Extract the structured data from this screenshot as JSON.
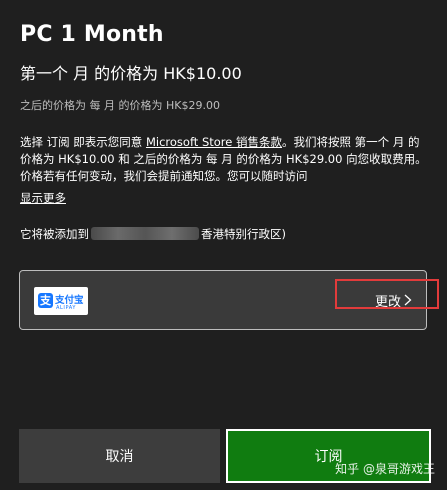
{
  "header": {
    "title": "PC 1 Month",
    "subtitle": "第一个 月 的价格为 HK$10.00",
    "after_price": "之后的价格为 每 月 的价格为 HK$29.00"
  },
  "terms": {
    "prefix": "选择 订阅 即表示您同意 ",
    "link": "Microsoft Store 销售条款",
    "suffix": "。我们将按照 第一个 月 的价格为 HK$10.00 和 之后的价格为 每 月 的价格为 HK$29.00 向您收取费用。价格若有任何变动，我们会提前通知您。您可以随时访问",
    "show_more": "显示更多"
  },
  "account": {
    "prefix": "它将被添加到",
    "suffix": "香港特别行政区)"
  },
  "payment": {
    "method_name": "支付宝",
    "method_en": "ALIPAY",
    "logo_glyph": "支",
    "brand_color": "#1677ff",
    "change_label": "更改",
    "chevron_icon": "chevron-right-icon"
  },
  "buttons": {
    "cancel": "取消",
    "subscribe": "订阅"
  },
  "watermark": "知乎 @泉哥游戏王",
  "colors": {
    "background": "#1f1f1f",
    "accent_green": "#107c10",
    "highlight_red": "#e23b3b"
  }
}
